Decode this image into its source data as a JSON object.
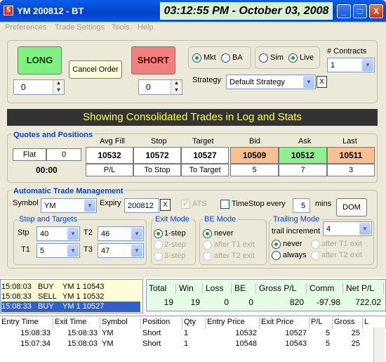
{
  "window": {
    "title": "YM 200812 - BT",
    "clock": "03:12:55 PM - October 03, 2008",
    "icon_text": "$"
  },
  "window_buttons": [
    "_",
    "□",
    "X"
  ],
  "menu": [
    "Preferences",
    "Trade Settings",
    "Tools",
    "Help"
  ],
  "orders": {
    "long_label": "LONG",
    "short_label": "SHORT",
    "cancel_label": "Cancel Order",
    "long_qty": "0",
    "short_qty": "0"
  },
  "mode": {
    "mkt": "Mkt",
    "ba": "BA",
    "sim": "Sim",
    "live": "Live",
    "contracts_label": "# Contracts",
    "contracts_value": "1"
  },
  "strategy": {
    "label": "Strategy",
    "value": "Default Strategy",
    "clear": "X"
  },
  "banner": "Showing Consolidated Trades in Log and Stats",
  "quotes": {
    "title": "Quotes and Positions",
    "position": "Flat",
    "position_qty": "0",
    "time": "00:00",
    "headers": [
      "Avg Fill",
      "Stop",
      "Target",
      "Bid",
      "Ask",
      "Last"
    ],
    "values": [
      "10532",
      "10572",
      "10527",
      "10509",
      "10512",
      "10511"
    ],
    "sub": [
      "P/L",
      "To Stop",
      "To Target",
      "5",
      "7",
      "3"
    ]
  },
  "atm": {
    "title": "Automatic Trade Management",
    "symbol_label": "Symbol",
    "symbol": "YM",
    "expiry_label": "Expiry",
    "expiry": "200812",
    "expiry_clear": "X",
    "ats": "ATS",
    "timestop": "TimeStop every",
    "timestop_val": "5",
    "mins": "mins",
    "dom": "DOM",
    "stops_title": "Stop and Targets",
    "stp": "Stp",
    "stp_val": "40",
    "t1": "T1",
    "t1_val": "5",
    "t2": "T2",
    "t2_val": "46",
    "t3": "T3",
    "t3_val": "47",
    "exit_title": "Exit Mode",
    "exit_opts": [
      "1-step",
      "2-step",
      "3-step"
    ],
    "be_title": "BE Mode",
    "be_opts": [
      "never",
      "after T1 exit",
      "after T2 exit"
    ],
    "trail_title": "Trailing Mode",
    "trail_inc": "trail increment",
    "trail_val": "4",
    "trail_left": [
      "never",
      "always"
    ],
    "trail_right": [
      "after T1 exit",
      "after T2 exit"
    ]
  },
  "log": [
    {
      "time": "15:08:03",
      "side": "BUY",
      "desc": "YM 1 10543"
    },
    {
      "time": "15:08:33",
      "side": "SELL",
      "desc": "YM 1 10532"
    },
    {
      "time": "15:08:33",
      "side": "BUY",
      "desc": "YM 1 10527"
    }
  ],
  "stats": {
    "headers": [
      "Total",
      "Win",
      "Loss",
      "BE",
      "Gross P/L",
      "Comm",
      "Net P/L"
    ],
    "values": [
      "19",
      "19",
      "0",
      "0",
      "820",
      "-97.98",
      "722.02"
    ]
  },
  "trades": {
    "headers": [
      "Entry Time",
      "Exit Time",
      "Symbol",
      "Position",
      "Qty",
      "Entry Price",
      "Exit Price",
      "P/L",
      "Gross",
      "L"
    ],
    "rows": [
      [
        "15:08:33",
        "15:08:33",
        "YM",
        "Short",
        "1",
        "10532",
        "10527",
        "5",
        "25"
      ],
      [
        "15:07:34",
        "15:08:03",
        "YM",
        "Short",
        "1",
        "10548",
        "10543",
        "5",
        "25"
      ]
    ]
  },
  "colors": {
    "long": "#80f080",
    "short": "#f08080",
    "bid": "#f8c090",
    "ask": "#90f090",
    "last": "#f8c090",
    "stats_bg": "#e6fbe6",
    "log_bg": "#fffdd8",
    "selected": "#3060c8"
  }
}
